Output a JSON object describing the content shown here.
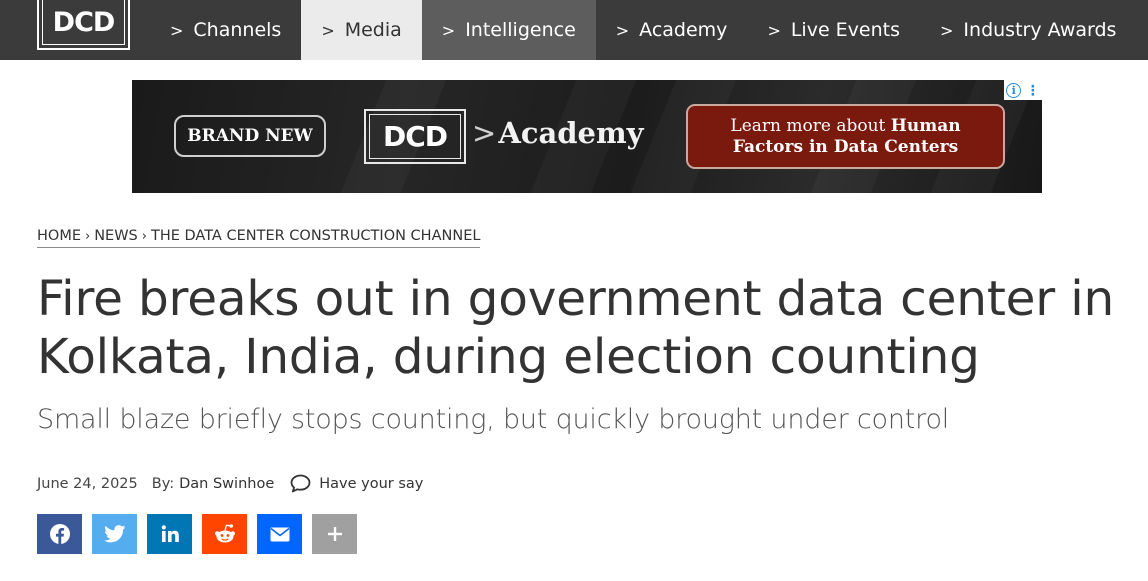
{
  "header": {
    "logo_text": "DCD",
    "nav": [
      {
        "label": "Channels"
      },
      {
        "label": "Media"
      },
      {
        "label": "Intelligence"
      },
      {
        "label": "Academy"
      },
      {
        "label": "Live Events"
      },
      {
        "label": "Industry Awards"
      }
    ],
    "nav_chevron": ">",
    "colors": {
      "bar": "#3b3b3b",
      "active": "#ebebeb",
      "hover": "#5d5d5d"
    }
  },
  "ad": {
    "badge": "BRAND NEW",
    "logo_text": "DCD",
    "product_prefix": ">",
    "product": "Academy",
    "cta_prefix": "Learn more about ",
    "cta_emphasis_1": "Human",
    "cta_emphasis_2": "Factors in Data Centers",
    "choices_icon": "info-icon",
    "menu_icon": "kebab-menu-icon",
    "colors": {
      "cta_bg": "#7a1a0e"
    }
  },
  "breadcrumb": {
    "items": [
      "HOME",
      "NEWS",
      "THE DATA CENTER CONSTRUCTION CHANNEL"
    ],
    "separator": "›"
  },
  "article": {
    "title_line_1": "Fire breaks out in government data center in",
    "title_line_2": "Kolkata, India, during election counting",
    "subtitle": "Small blaze briefly stops counting, but quickly brought under control",
    "date": "June 24, 2025",
    "by_label": "By:",
    "author": "Dan Swinhoe",
    "comment_label": "Have your say",
    "comment_icon": "speech-bubble-icon"
  },
  "share": [
    {
      "name": "facebook",
      "icon": "facebook-icon",
      "color": "#3b5998"
    },
    {
      "name": "twitter",
      "icon": "twitter-icon",
      "color": "#55acee"
    },
    {
      "name": "linkedin",
      "icon": "linkedin-icon",
      "color": "#0077b5"
    },
    {
      "name": "reddit",
      "icon": "reddit-icon",
      "color": "#ff4500"
    },
    {
      "name": "email",
      "icon": "email-icon",
      "color": "#0166ff"
    },
    {
      "name": "more",
      "icon": "plus-icon",
      "color": "#a0a0a0"
    }
  ]
}
